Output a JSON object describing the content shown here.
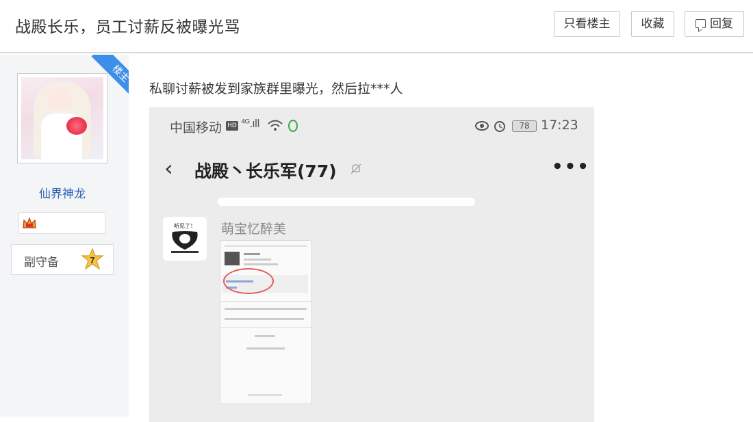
{
  "header": {
    "title": "战殿长乐，员工讨薪反被曝光骂",
    "btn_only_op": "只看楼主",
    "btn_favorite": "收藏",
    "btn_reply": "回复"
  },
  "author": {
    "corner_tag": "楼主",
    "name": "仙界神龙",
    "rank_title": "副守备",
    "rank_level": "7"
  },
  "post": {
    "text": "私聊讨薪被发到家族群里曝光，然后拉***人"
  },
  "screenshot": {
    "carrier": "中国移动",
    "hd": "HD",
    "signal": "⁴ᴳ.ıll",
    "battery": "78",
    "time": "17:23",
    "back": "‹",
    "chat_title": "战殿丶长乐军(77)",
    "more": "•••",
    "sender_name": "萌宝忆醉美",
    "sticker_text": "听见了！"
  },
  "colors": {
    "link": "#2d64b3",
    "corner_badge": "#3d8ee9",
    "sidebar_bg": "#f4f5f7",
    "circle_mark": "#e05a5a"
  }
}
